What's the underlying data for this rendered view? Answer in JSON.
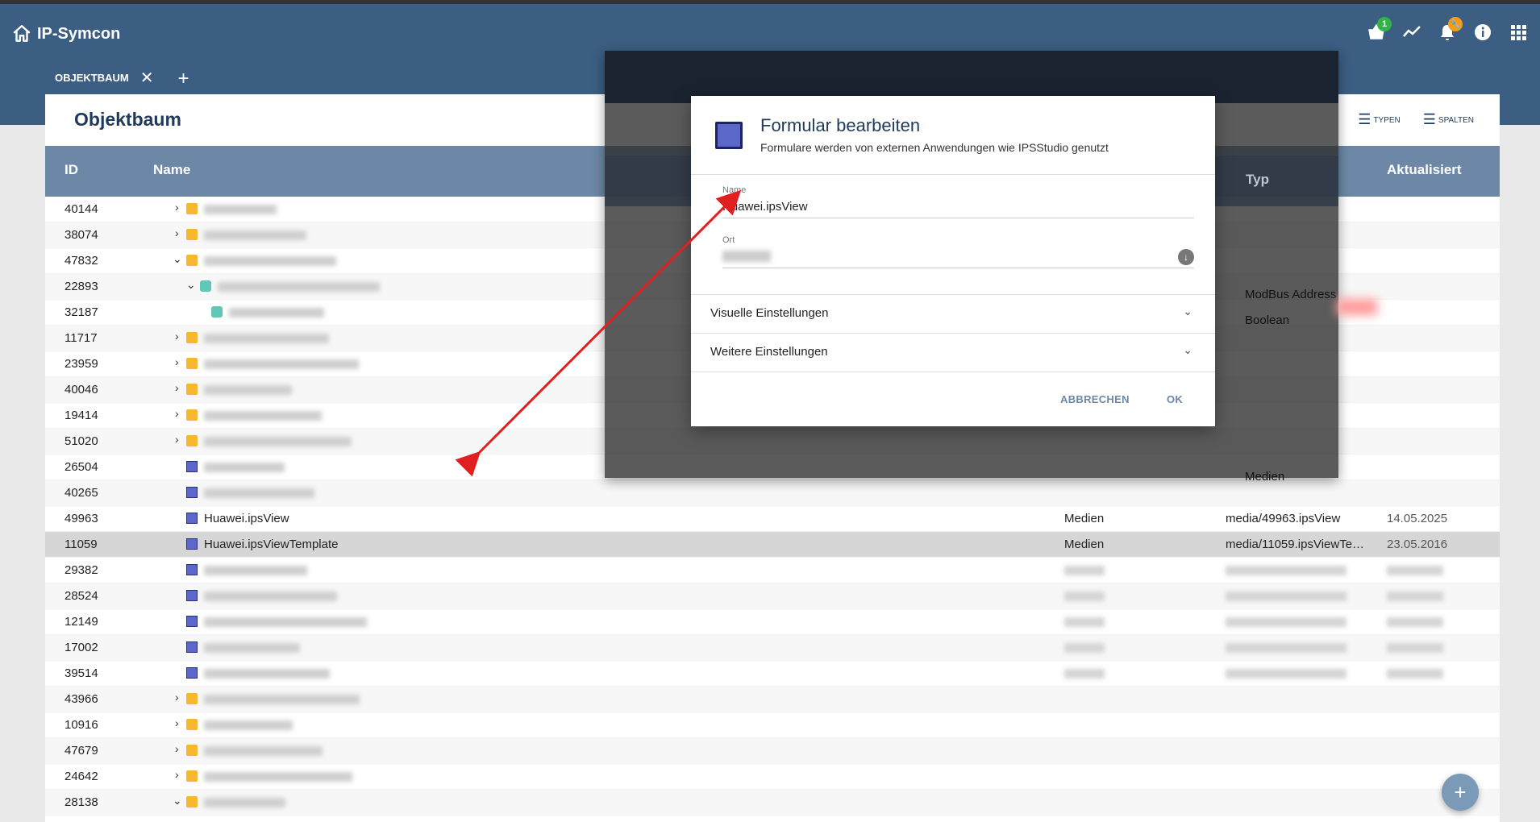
{
  "app": {
    "brand": "IP-Symcon",
    "icons": [
      "home-icon",
      "basket-icon",
      "chart-icon",
      "bell-icon",
      "info-icon",
      "apps-icon"
    ],
    "basket_badge": "1",
    "bell_badge": "🔧"
  },
  "tabs": [
    {
      "label": "OBJEKTBAUM"
    }
  ],
  "panel": {
    "title": "Objektbaum",
    "tool_types": "TYPEN",
    "tool_columns": "SPALTEN"
  },
  "table": {
    "headers": {
      "id": "ID",
      "name": "Name",
      "updated": "Aktualisiert"
    },
    "rows": [
      {
        "id": "40144",
        "name": "",
        "type": "",
        "path": "",
        "date": ""
      },
      {
        "id": "38074",
        "name": "",
        "type": "",
        "path": "",
        "date": ""
      },
      {
        "id": "47832",
        "name": "",
        "type": "",
        "path": "",
        "date": ""
      },
      {
        "id": "22893",
        "name": "",
        "type": "",
        "path": "",
        "date": ""
      },
      {
        "id": "32187",
        "name": "",
        "type": "",
        "path": "",
        "date": ""
      },
      {
        "id": "11717",
        "name": "",
        "type": "",
        "path": "",
        "date": ""
      },
      {
        "id": "23959",
        "name": "",
        "type": "",
        "path": "",
        "date": ""
      },
      {
        "id": "40046",
        "name": "",
        "type": "",
        "path": "",
        "date": ""
      },
      {
        "id": "19414",
        "name": "",
        "type": "",
        "path": "",
        "date": ""
      },
      {
        "id": "51020",
        "name": "",
        "type": "",
        "path": "",
        "date": ""
      },
      {
        "id": "26504",
        "name": "",
        "type": "",
        "path": "",
        "date": ""
      },
      {
        "id": "40265",
        "name": "",
        "type": "",
        "path": "",
        "date": ""
      },
      {
        "id": "49963",
        "name": "Huawei.ipsView",
        "type": "Medien",
        "path": "media/49963.ipsView",
        "date": "14.05.2025"
      },
      {
        "id": "11059",
        "name": "Huawei.ipsViewTemplate",
        "type": "Medien",
        "path": "media/11059.ipsViewTe…",
        "date": "23.05.2016"
      },
      {
        "id": "29382",
        "name": "",
        "type": "",
        "path": "",
        "date": ""
      },
      {
        "id": "28524",
        "name": "",
        "type": "",
        "path": "",
        "date": ""
      },
      {
        "id": "12149",
        "name": "",
        "type": "",
        "path": "",
        "date": ""
      },
      {
        "id": "17002",
        "name": "",
        "type": "",
        "path": "",
        "date": ""
      },
      {
        "id": "39514",
        "name": "",
        "type": "",
        "path": "",
        "date": ""
      },
      {
        "id": "43966",
        "name": "",
        "type": "",
        "path": "",
        "date": ""
      },
      {
        "id": "10916",
        "name": "",
        "type": "",
        "path": "",
        "date": ""
      },
      {
        "id": "47679",
        "name": "",
        "type": "",
        "path": "",
        "date": ""
      },
      {
        "id": "24642",
        "name": "",
        "type": "",
        "path": "",
        "date": ""
      },
      {
        "id": "28138",
        "name": "",
        "type": "",
        "path": "",
        "date": ""
      }
    ]
  },
  "background_dialog": {
    "typ_header": "Typ",
    "value_1": "ModBus Address",
    "value_2": "Boolean",
    "value_3": "Medien"
  },
  "dialog": {
    "title": "Formular bearbeiten",
    "subtitle": "Formulare werden von externen Anwendungen wie IPSStudio genutzt",
    "name_label": "Name",
    "name_value": "Huawei.ipsView",
    "location_label": "Ort",
    "section_visual": "Visuelle Einstellungen",
    "section_more": "Weitere Einstellungen",
    "cancel": "ABBRECHEN",
    "ok": "OK"
  },
  "colors": {
    "header": "#3c5e82",
    "table_header": "#6d88a6",
    "annotation_arrow": "#e02020"
  }
}
